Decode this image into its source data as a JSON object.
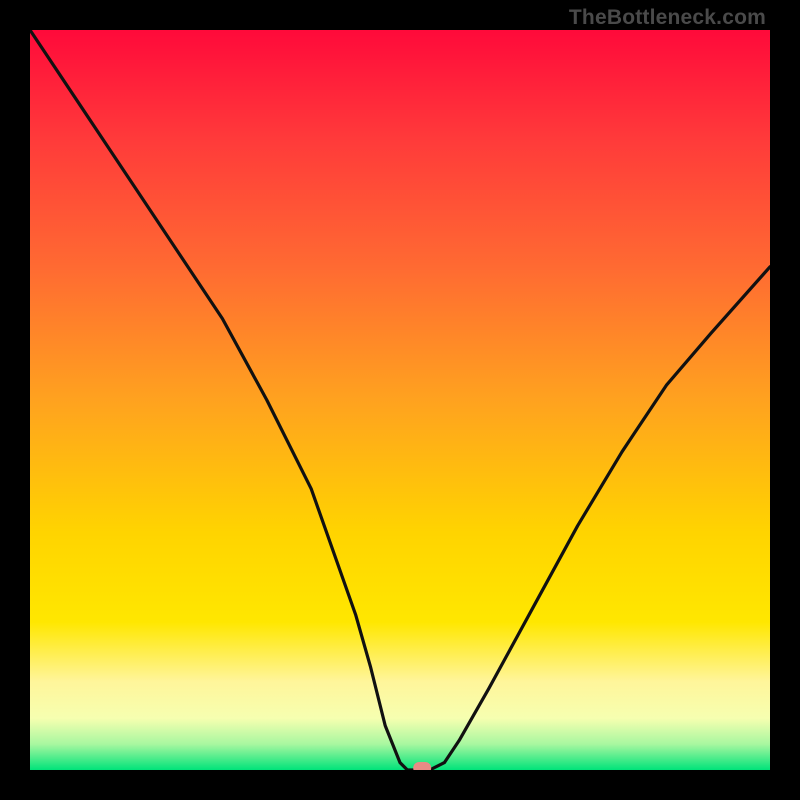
{
  "watermark": "TheBottleneck.com",
  "chart_data": {
    "type": "line",
    "title": "",
    "xlabel": "",
    "ylabel": "",
    "xlim": [
      0,
      100
    ],
    "ylim": [
      0,
      100
    ],
    "series": [
      {
        "name": "bottleneck-curve",
        "x": [
          0,
          8,
          14,
          20,
          26,
          32,
          38,
          44,
          46,
          48,
          50,
          51,
          52,
          54,
          56,
          58,
          62,
          68,
          74,
          80,
          86,
          92,
          100
        ],
        "y": [
          100,
          88,
          79,
          70,
          61,
          50,
          38,
          21,
          14,
          6,
          1,
          0,
          0,
          0,
          1,
          4,
          11,
          22,
          33,
          43,
          52,
          59,
          68
        ]
      }
    ],
    "marker": {
      "x": 53,
      "y": 0
    },
    "gradient_stops": [
      {
        "offset": 0.0,
        "color": "#ff0a3a"
      },
      {
        "offset": 0.15,
        "color": "#ff3b3a"
      },
      {
        "offset": 0.32,
        "color": "#ff6a32"
      },
      {
        "offset": 0.5,
        "color": "#ffa21f"
      },
      {
        "offset": 0.68,
        "color": "#ffd400"
      },
      {
        "offset": 0.8,
        "color": "#ffe700"
      },
      {
        "offset": 0.88,
        "color": "#fff59a"
      },
      {
        "offset": 0.93,
        "color": "#f6ffb0"
      },
      {
        "offset": 0.965,
        "color": "#a8f7a0"
      },
      {
        "offset": 1.0,
        "color": "#00e37a"
      }
    ]
  }
}
